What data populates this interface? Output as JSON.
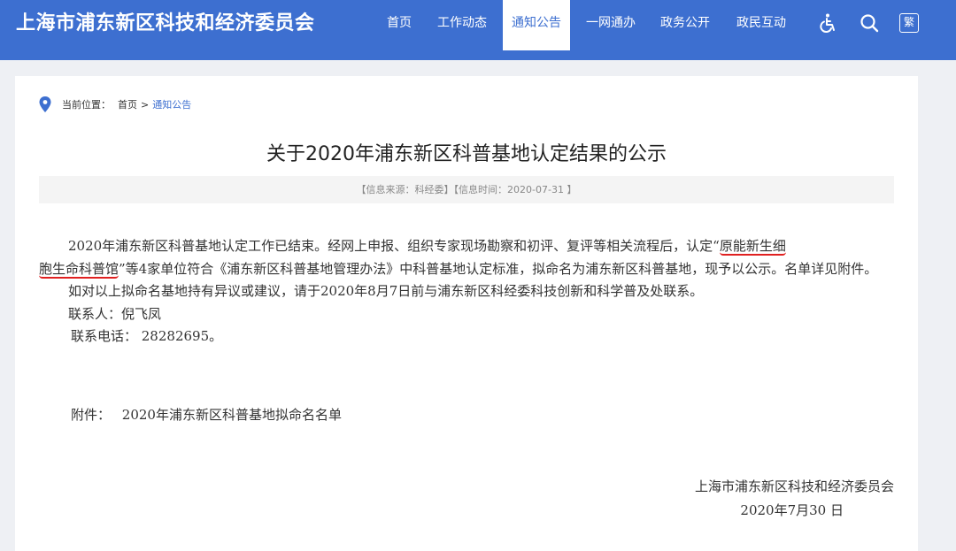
{
  "header": {
    "site_title": "上海市浦东新区科技和经济委员会",
    "nav": [
      {
        "label": "首页"
      },
      {
        "label": "工作动态"
      },
      {
        "label": "通知公告",
        "active": true
      },
      {
        "label": "一网通办"
      },
      {
        "label": "政务公开"
      },
      {
        "label": "政民互动"
      }
    ],
    "tools": {
      "accessibility": "wheelchair-icon",
      "search": "search-icon",
      "traditional_label": "繁"
    }
  },
  "breadcrumb": {
    "prefix": "当前位置：",
    "home": "首页",
    "separator": ">",
    "current": "通知公告"
  },
  "article": {
    "title": "关于2020年浦东新区科普基地认定结果的公示",
    "meta": "【信息来源：科经委】【信息时间：2020-07-31 】",
    "p1_before": "2020年浦东新区科普基地认定工作已结束。经网上申报、组织专家现场勘察和初评、复评等相关流程后，认定“",
    "p1_highlight_a": "原能新生细",
    "p1_highlight_b": "胞生命科普馆",
    "p1_after": "”等4家单位符合《浦东新区科普基地管理办法》中科普基地认定标准，拟命名为浦东新区科普基地，现予以公示。名单详见附件。",
    "p2": "如对以上拟命名基地持有异议或建议，请于2020年8月7日前与浦东新区科经委科技创新和科学普及处联系。",
    "contact": "联系人：倪飞凤",
    "phone": "联系电话： 28282695。",
    "attach_label": "附件：",
    "attach_link": "2020年浦东新区科普基地拟命名名单",
    "sign_org": "上海市浦东新区科技和经济委员会",
    "sign_date": "2020年7月30 日"
  },
  "colors": {
    "brand_blue": "#3d6fd0",
    "highlight_red": "#e02020"
  }
}
